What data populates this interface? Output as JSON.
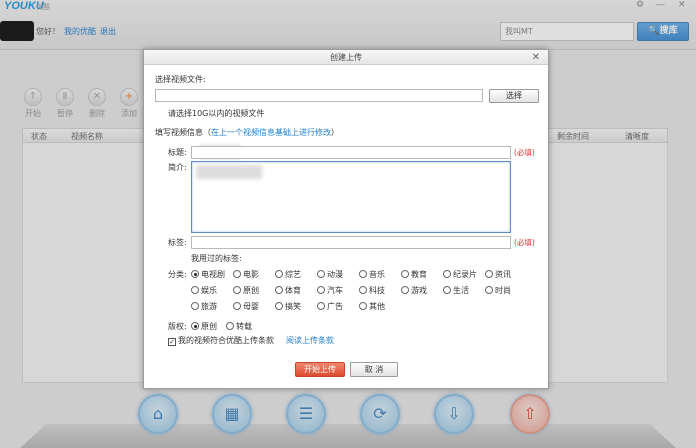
{
  "app": {
    "logo": "YOUKU",
    "logo_sub": "优酷",
    "win_gear": "⚙",
    "win_min": "—",
    "win_close": "✕"
  },
  "header": {
    "greeting": "您好！",
    "my_youku": "我的优酷",
    "logout": "退出",
    "search_value": "我叫MT",
    "search_button": "搜库"
  },
  "toolbar": [
    {
      "label": "开始",
      "icon": "arrow-up-icon",
      "glyph": "↑"
    },
    {
      "label": "暂停",
      "icon": "pause-icon",
      "glyph": "Ⅱ"
    },
    {
      "label": "删除",
      "icon": "delete-icon",
      "glyph": "✕"
    },
    {
      "label": "添加",
      "icon": "add-icon",
      "glyph": "+"
    }
  ],
  "table": {
    "columns": [
      "状态",
      "视频名称",
      "剩余时间",
      "清晰度"
    ]
  },
  "dock": [
    {
      "name": "home-icon",
      "glyph": "⌂"
    },
    {
      "name": "film-icon",
      "glyph": "▦"
    },
    {
      "name": "playlist-icon",
      "glyph": "☰"
    },
    {
      "name": "refresh-icon",
      "glyph": "⟳"
    },
    {
      "name": "download-icon",
      "glyph": "⇩"
    },
    {
      "name": "upload-icon",
      "glyph": "⇧"
    }
  ],
  "dialog": {
    "title": "创建上传",
    "close": "✕",
    "select_file_label": "选择视频文件:",
    "file_value": "",
    "select_button": "选择",
    "size_hint": "请选择10G以内的视频文件",
    "info_label": "填写视频信息（",
    "info_link": "在上一个视频信息基础上进行修改",
    "info_close": "）",
    "title_label": "标题:",
    "title_value": "",
    "required": "(必填)",
    "desc_label": "简介:",
    "desc_value": "",
    "tags_label": "标签:",
    "tags_value": "",
    "used_tags": "我用过的标签:",
    "category_label": "分类:",
    "categories": [
      "电视剧",
      "电影",
      "综艺",
      "动漫",
      "音乐",
      "教育",
      "纪录片",
      "资讯",
      "娱乐",
      "原创",
      "体育",
      "汽车",
      "科技",
      "游戏",
      "生活",
      "时尚",
      "旅游",
      "母婴",
      "搞笑",
      "广告",
      "其他"
    ],
    "selected_category": "电视剧",
    "copyright_label": "版权:",
    "copyright_options": [
      "原创",
      "转载"
    ],
    "selected_copyright": "原创",
    "agree_text": "我的视频符合优酷上传条款",
    "agree_link": "阅读上传条款",
    "agree_checked": true,
    "start_upload": "开始上传",
    "cancel": "取 消"
  }
}
